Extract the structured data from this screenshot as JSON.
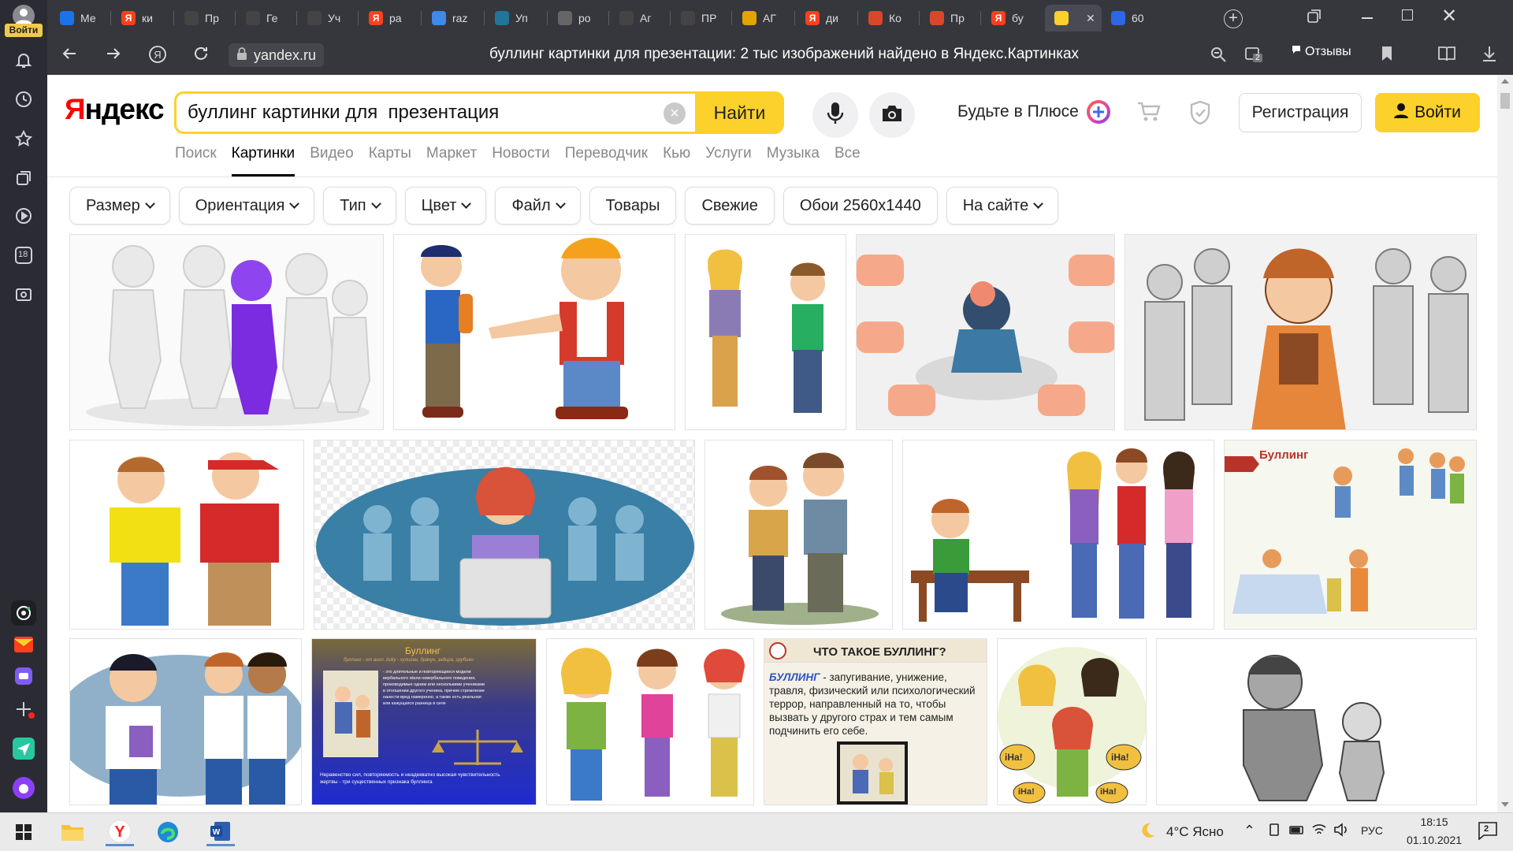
{
  "sidebar": {
    "login_badge": "Войти",
    "icons": [
      "avatar-icon",
      "bell-icon",
      "history-icon",
      "star-icon",
      "collections-icon",
      "play-icon",
      "age-rating-icon",
      "screenshot-icon"
    ],
    "age_label": "18"
  },
  "tabs": [
    {
      "label": "Ме",
      "fav": "#1a73e8"
    },
    {
      "label": "ки",
      "fav": "#fc3f1d",
      "glyph": "Я"
    },
    {
      "label": "Пр",
      "fav": "#444"
    },
    {
      "label": "Ге",
      "fav": "#444"
    },
    {
      "label": "Уч",
      "fav": "#444"
    },
    {
      "label": "ра",
      "fav": "#fc3f1d",
      "glyph": "Я"
    },
    {
      "label": "raz",
      "fav": "#3d8ae8"
    },
    {
      "label": "Уп",
      "fav": "#21759b"
    },
    {
      "label": "ро",
      "fav": "#666"
    },
    {
      "label": "Аг",
      "fav": "#444"
    },
    {
      "label": "ПР",
      "fav": "#444"
    },
    {
      "label": "АГ",
      "fav": "#e3a400"
    },
    {
      "label": "ди",
      "fav": "#fc3f1d",
      "glyph": "Я"
    },
    {
      "label": "Ко",
      "fav": "#d9472b"
    },
    {
      "label": "Пр",
      "fav": "#d9472b"
    },
    {
      "label": "бу",
      "fav": "#fc3f1d",
      "glyph": "Я"
    },
    {
      "label": "",
      "fav": "#fdd12b",
      "active": true
    },
    {
      "label": "60",
      "fav": "#2c67e6"
    }
  ],
  "address": {
    "url": "yandex.ru",
    "title": "буллинг картинки для презентации: 2 тыс изображений найдено в Яндекс.Картинках",
    "reviews_label": "Отзывы",
    "downloads_count": "2"
  },
  "header": {
    "logo_y": "Я",
    "logo_rest": "ндекс",
    "query": "буллинг картинки для  презентация",
    "find_label": "Найти",
    "plus_label": "Будьте в Плюсе",
    "register_label": "Регистрация",
    "login_label": "Войти"
  },
  "services": [
    "Поиск",
    "Картинки",
    "Видео",
    "Карты",
    "Маркет",
    "Новости",
    "Переводчик",
    "Кью",
    "Услуги",
    "Музыка",
    "Все"
  ],
  "active_service": "Картинки",
  "filters": [
    {
      "label": "Размер",
      "dropdown": true
    },
    {
      "label": "Ориентация",
      "dropdown": true
    },
    {
      "label": "Тип",
      "dropdown": true
    },
    {
      "label": "Цвет",
      "dropdown": true
    },
    {
      "label": "Файл",
      "dropdown": true
    },
    {
      "label": "Товары",
      "dropdown": false
    },
    {
      "label": "Свежие",
      "dropdown": false
    },
    {
      "label": "Обои 2560x1440",
      "dropdown": false
    },
    {
      "label": "На сайте",
      "dropdown": true
    }
  ],
  "results": {
    "slide_card_1": {
      "title": "Буллинг",
      "subtitle": "буллинг - от англ. bully - хулиган, драчун, задира, грубиян",
      "lines": [
        "- это длительные и повторяющиеся модели",
        "вербального и/или невербального поведения,",
        "производимые одним или несколькими учениками",
        "в отношении другого ученика, причем стремление",
        "нанести вред намеренно, а также есть реальная",
        "или кажущаяся разница в силе"
      ],
      "footer": "Неравенство сил, повторяемость и неадекватно высокая чувствительность жертвы - три существенных признака буллинга"
    },
    "slide_card_2": {
      "title": "ЧТО ТАКОЕ БУЛЛИНГ?",
      "term": "БУЛЛИНГ",
      "definition": " - запугивание, унижение, травля, физический или психологический террор, направленный на то, чтобы вызвать у другого страх и тем самым подчинить его себе."
    },
    "comic_card": {
      "title": "Буллинг"
    },
    "speech_bubble": "iHa!"
  },
  "taskbar": {
    "weather": "4°C Ясно",
    "lang": "РУС",
    "time": "18:15",
    "date": "01.10.2021",
    "notifications": "2"
  }
}
